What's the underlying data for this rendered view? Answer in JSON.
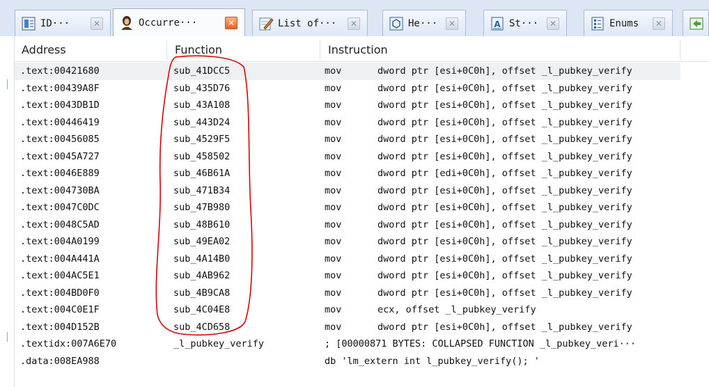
{
  "tabs": [
    {
      "label": "ID···",
      "icon": "document-view-icon",
      "active": false
    },
    {
      "label": "Occurre···",
      "icon": "person-icon",
      "active": true
    },
    {
      "label": "List of···",
      "icon": "pencil-note-icon",
      "active": false
    },
    {
      "label": "He···",
      "icon": "hex-view-icon",
      "active": false
    },
    {
      "label": "St···",
      "icon": "structures-icon",
      "active": false
    },
    {
      "label": "Enums",
      "icon": "enums-icon",
      "active": false
    },
    {
      "label": "",
      "icon": "imports-icon",
      "active": false
    }
  ],
  "close_glyph": "✕",
  "table": {
    "columns": [
      "Address",
      "Function",
      "Instruction"
    ],
    "rows": [
      {
        "address": ".text:00421680",
        "function": "sub_41DCC5",
        "mnemonic": "mov",
        "operands": "dword ptr [esi+0C0h], offset _l_pubkey_verify"
      },
      {
        "address": ".text:00439A8F",
        "function": "sub_435D76",
        "mnemonic": "mov",
        "operands": "dword ptr [esi+0C0h], offset _l_pubkey_verify"
      },
      {
        "address": ".text:0043DB1D",
        "function": "sub_43A108",
        "mnemonic": "mov",
        "operands": "dword ptr [esi+0C0h], offset _l_pubkey_verify"
      },
      {
        "address": ".text:00446419",
        "function": "sub_443D24",
        "mnemonic": "mov",
        "operands": "dword ptr [esi+0C0h], offset _l_pubkey_verify"
      },
      {
        "address": ".text:00456085",
        "function": "sub_4529F5",
        "mnemonic": "mov",
        "operands": "dword ptr [esi+0C0h], offset _l_pubkey_verify"
      },
      {
        "address": ".text:0045A727",
        "function": "sub_458502",
        "mnemonic": "mov",
        "operands": "dword ptr [esi+0C0h], offset _l_pubkey_verify"
      },
      {
        "address": ".text:0046E889",
        "function": "sub_46B61A",
        "mnemonic": "mov",
        "operands": "dword ptr [edi+0C0h], offset _l_pubkey_verify"
      },
      {
        "address": ".text:004730BA",
        "function": "sub_471B34",
        "mnemonic": "mov",
        "operands": "dword ptr [esi+0C0h], offset _l_pubkey_verify"
      },
      {
        "address": ".text:0047C0DC",
        "function": "sub_47B980",
        "mnemonic": "mov",
        "operands": "dword ptr [esi+0C0h], offset _l_pubkey_verify"
      },
      {
        "address": ".text:0048C5AD",
        "function": "sub_48B610",
        "mnemonic": "mov",
        "operands": "dword ptr [esi+0C0h], offset _l_pubkey_verify"
      },
      {
        "address": ".text:004A0199",
        "function": "sub_49EA02",
        "mnemonic": "mov",
        "operands": "dword ptr [esi+0C0h], offset _l_pubkey_verify"
      },
      {
        "address": ".text:004A441A",
        "function": "sub_4A14B0",
        "mnemonic": "mov",
        "operands": "dword ptr [esi+0C0h], offset _l_pubkey_verify"
      },
      {
        "address": ".text:004AC5E1",
        "function": "sub_4AB962",
        "mnemonic": "mov",
        "operands": "dword ptr [esi+0C0h], offset _l_pubkey_verify"
      },
      {
        "address": ".text:004BD0F0",
        "function": "sub_4B9CA8",
        "mnemonic": "mov",
        "operands": "dword ptr [esi+0C0h], offset _l_pubkey_verify"
      },
      {
        "address": ".text:004C0E1F",
        "function": "sub_4C04E8",
        "mnemonic": "mov",
        "operands": "ecx, offset _l_pubkey_verify"
      },
      {
        "address": ".text:004D152B",
        "function": "sub_4CD658",
        "mnemonic": "mov",
        "operands": "dword ptr [esi+0C0h], offset _l_pubkey_verify"
      },
      {
        "address": ".textidx:007A6E70",
        "function": "_l_pubkey_verify",
        "instruction": "; [00000871 BYTES: COLLAPSED FUNCTION _l_pubkey_veri···"
      },
      {
        "address": ".data:008EA988",
        "function": "",
        "instruction": "db 'lm_extern int l_pubkey_verify();  '"
      }
    ]
  },
  "colors": {
    "annotation": "#e00000",
    "selected_row": "#eef0f2",
    "tab_strip": "#dce6f4",
    "active_close": "#e8622a"
  }
}
